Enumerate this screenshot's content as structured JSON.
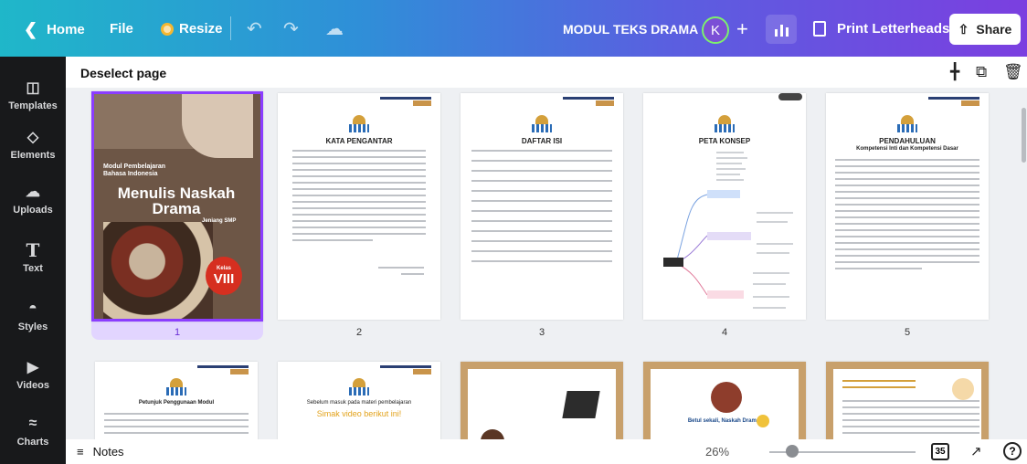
{
  "topbar": {
    "home_label": "Home",
    "file_label": "File",
    "resize_label": "Resize",
    "doc_title": "MODUL TEKS DRAMA",
    "avatar_initial": "K",
    "print_label": "Print Letterheads",
    "share_label": "Share"
  },
  "sidebar": {
    "items": [
      {
        "label": "Templates",
        "icon": "templates-icon"
      },
      {
        "label": "Elements",
        "icon": "elements-icon"
      },
      {
        "label": "Uploads",
        "icon": "uploads-icon"
      },
      {
        "label": "Text",
        "icon": "text-icon"
      },
      {
        "label": "Styles",
        "icon": "styles-icon"
      },
      {
        "label": "Videos",
        "icon": "videos-icon"
      },
      {
        "label": "Charts",
        "icon": "charts-icon"
      }
    ]
  },
  "subbar": {
    "deselect_label": "Deselect page"
  },
  "pages": [
    {
      "number": "1",
      "title": "Menulis Naskah Drama",
      "subtitle": "Modul Pembelajaran Bahasa Indonesia",
      "level": "Jenjang SMP",
      "kelas_label": "Kelas",
      "kelas": "VIII"
    },
    {
      "number": "2",
      "title": "KATA PENGANTAR"
    },
    {
      "number": "3",
      "title": "DAFTAR ISI"
    },
    {
      "number": "4",
      "title": "PETA KONSEP"
    },
    {
      "number": "5",
      "title": "PENDAHULUAN",
      "subtitle": "Kompetensi Inti dan Kompetensi Dasar"
    }
  ],
  "bottom_pages": [
    {
      "title": "Petunjuk Penggunaan Modul"
    },
    {
      "title": "Sebelum masuk pada materi pembelajaran",
      "subtitle": "Simak video berikut ini!"
    },
    {
      "title": ""
    },
    {
      "title": "Betul sekali, Naskah Drama!"
    },
    {
      "title": ""
    }
  ],
  "footer": {
    "notes_label": "Notes",
    "zoom": "26%",
    "page_count": "35"
  },
  "colors": {
    "accent": "#8b3dff",
    "topbar_start": "#1fb7c9",
    "topbar_end": "#7b3fe0"
  }
}
